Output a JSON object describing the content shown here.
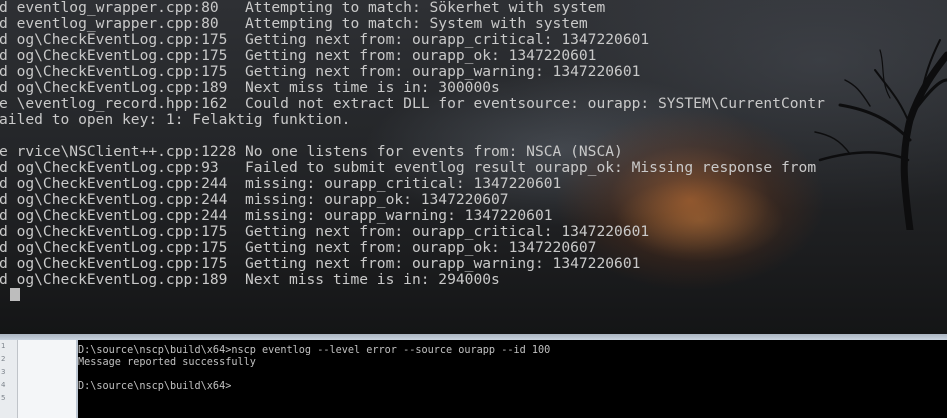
{
  "top_console": {
    "lines": [
      "d eventlog_wrapper.cpp:80   Attempting to match: Sökerhet with system",
      "d eventlog_wrapper.cpp:80   Attempting to match: System with system",
      "d og\\CheckEventLog.cpp:175  Getting next from: ourapp_critical: 1347220601",
      "d og\\CheckEventLog.cpp:175  Getting next from: ourapp_ok: 1347220601",
      "d og\\CheckEventLog.cpp:175  Getting next from: ourapp_warning: 1347220601",
      "d og\\CheckEventLog.cpp:189  Next miss time is in: 300000s",
      "e \\eventlog_record.hpp:162  Could not extract DLL for eventsource: ourapp: SYSTEM\\CurrentContr",
      "ailed to open key: 1: Felaktig funktion.",
      "",
      "e rvice\\NSClient++.cpp:1228 No one listens for events from: NSCA (NSCA)",
      "d og\\CheckEventLog.cpp:93   Failed to submit eventlog result ourapp_ok: Missing response from",
      "d og\\CheckEventLog.cpp:244  missing: ourapp_critical: 1347220601",
      "d og\\CheckEventLog.cpp:244  missing: ourapp_ok: 1347220607",
      "d og\\CheckEventLog.cpp:244  missing: ourapp_warning: 1347220601",
      "d og\\CheckEventLog.cpp:175  Getting next from: ourapp_critical: 1347220601",
      "d og\\CheckEventLog.cpp:175  Getting next from: ourapp_ok: 1347220607",
      "d og\\CheckEventLog.cpp:175  Getting next from: ourapp_warning: 1347220601",
      "d og\\CheckEventLog.cpp:189  Next miss time is in: 294000s"
    ]
  },
  "editor": {
    "line_numbers": [
      "1",
      "2",
      "3",
      "4",
      "5"
    ]
  },
  "bottom_console": {
    "lines": [
      "D:\\source\\nscp\\build\\x64>nscp eventlog --level error --source ourapp --id 100",
      "Message reported successfully",
      "",
      "D:\\source\\nscp\\build\\x64>"
    ]
  },
  "colors": {
    "console_text": "#c9c9c9",
    "bottom_console_bg": "#000000",
    "fire_glow": "#cd6e2d"
  }
}
